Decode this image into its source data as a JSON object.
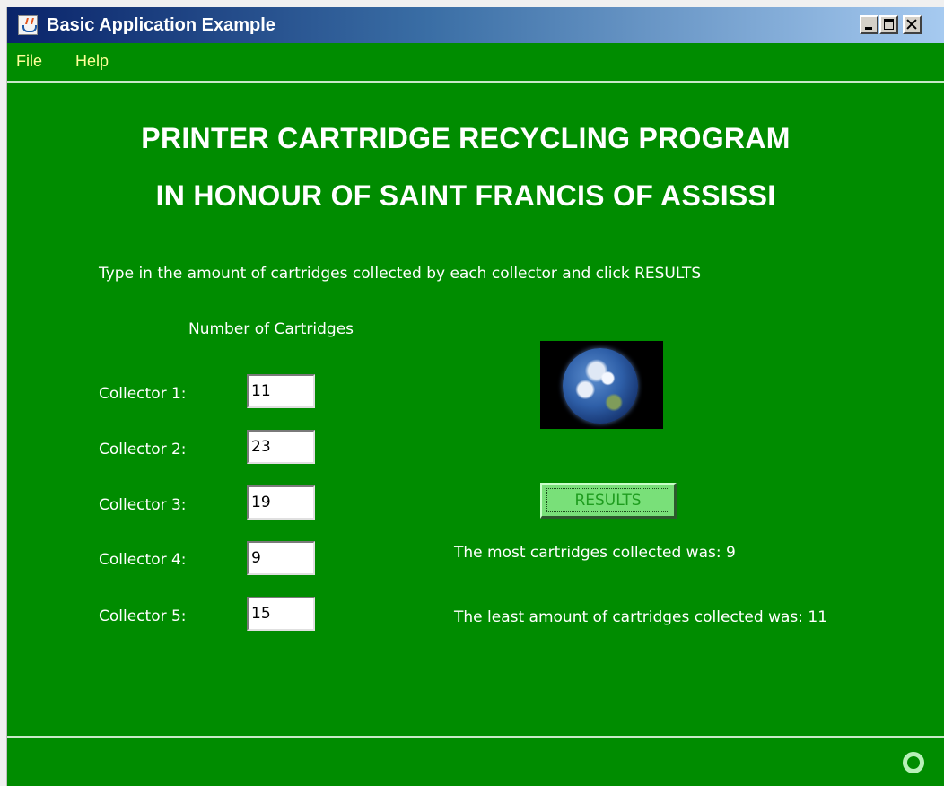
{
  "window": {
    "title": "Basic Application Example"
  },
  "menu": {
    "file": "File",
    "help": "Help"
  },
  "main": {
    "heading_line1": "PRINTER CARTRIDGE RECYCLING PROGRAM",
    "heading_line2": "IN HONOUR OF SAINT FRANCIS OF ASSISSI",
    "instructions": "Type in the amount of cartridges collected by each collector and click RESULTS",
    "column_header": "Number of Cartridges",
    "collectors": [
      {
        "label": "Collector 1:",
        "value": "11"
      },
      {
        "label": "Collector 2:",
        "value": "23"
      },
      {
        "label": "Collector 3:",
        "value": "19"
      },
      {
        "label": "Collector 4:",
        "value": "9"
      },
      {
        "label": "Collector 5:",
        "value": "15"
      }
    ],
    "results_button": "RESULTS",
    "most_result": "The most cartridges collected was: 9",
    "least_result": "The least amount of cartridges collected was: 11"
  },
  "icons": {
    "app": "java-cup-icon",
    "image": "earth-globe-icon",
    "status": "ring-icon"
  },
  "colors": {
    "background": "#008c00",
    "heading": "#ffffff",
    "menu_text": "#ffff99",
    "button_face": "#79e079",
    "button_text": "#1f9c1f"
  }
}
